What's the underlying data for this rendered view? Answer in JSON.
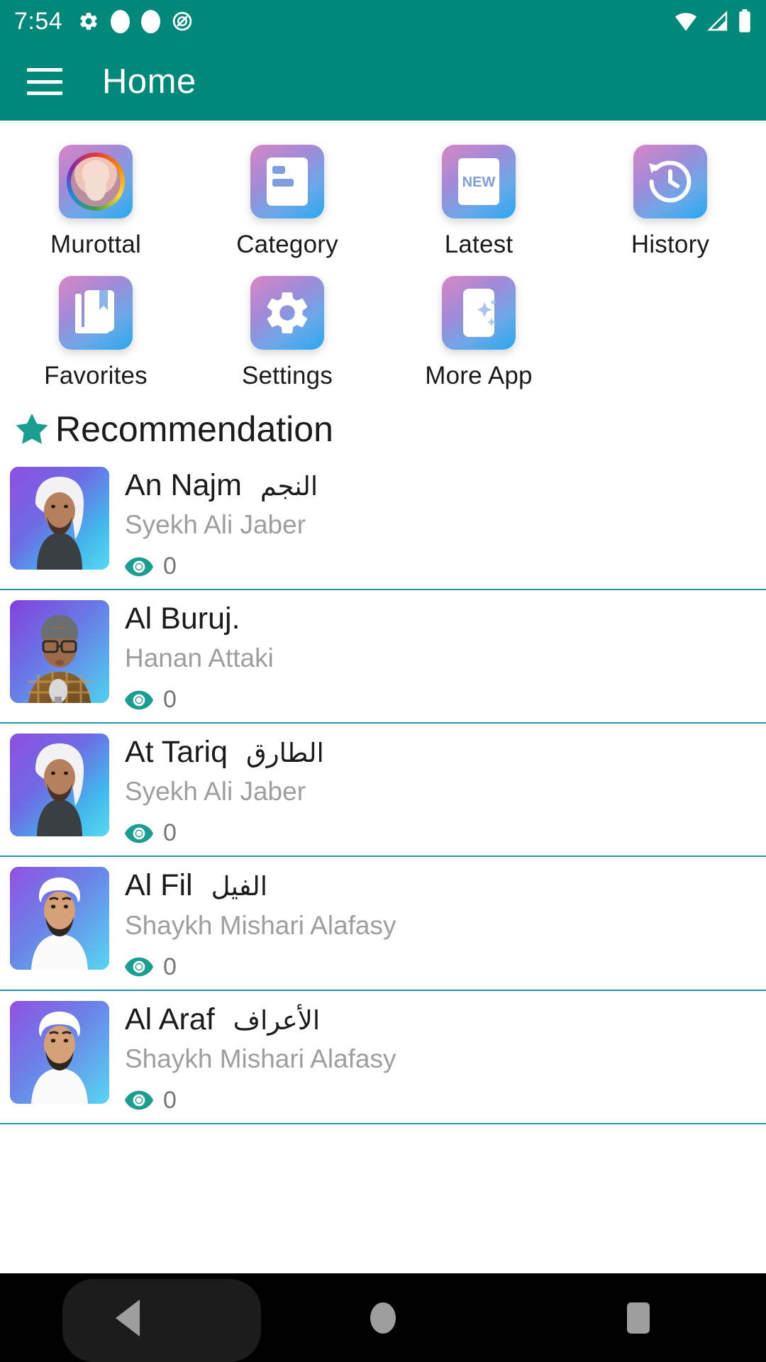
{
  "status_bar": {
    "time": "7:54",
    "left_icons": [
      "gear-icon",
      "dot-icon",
      "dot-icon",
      "no-entry-icon"
    ],
    "right_icons": [
      "wifi-icon",
      "signal-icon",
      "battery-icon"
    ]
  },
  "app_bar": {
    "menu_icon": "hamburger-menu-icon",
    "title": "Home",
    "background_color": "#00897B"
  },
  "grid_menu": {
    "items": [
      {
        "label": "Murottal",
        "icon": "avatar-portrait-icon"
      },
      {
        "label": "Category",
        "icon": "list-card-icon"
      },
      {
        "label": "Latest",
        "icon": "new-badge-icon"
      },
      {
        "label": "History",
        "icon": "clock-rotate-left-icon"
      },
      {
        "label": "Favorites",
        "icon": "bookmark-books-icon"
      },
      {
        "label": "Settings",
        "icon": "gear-icon"
      },
      {
        "label": "More App",
        "icon": "phone-sparkle-icon"
      }
    ]
  },
  "recommendation": {
    "icon": "star-icon",
    "title": "Recommendation",
    "accent_color": "#1a9e8f",
    "divider_color": "#2196a8",
    "items": [
      {
        "title": "An Najm",
        "arabic": "النجم",
        "reciter": "Syekh Ali Jaber",
        "views_icon": "eye-icon",
        "views": "0",
        "thumb": "syekh-ali-jaber-portrait"
      },
      {
        "title": "Al Buruj.",
        "arabic": "",
        "reciter": "Hanan Attaki",
        "views_icon": "eye-icon",
        "views": "0",
        "thumb": "hanan-attaki-portrait"
      },
      {
        "title": "At Tariq",
        "arabic": "الطارق",
        "reciter": "Syekh Ali Jaber",
        "views_icon": "eye-icon",
        "views": "0",
        "thumb": "syekh-ali-jaber-portrait"
      },
      {
        "title": "Al Fil",
        "arabic": "الفيل",
        "reciter": "Shaykh Mishari Alafasy",
        "views_icon": "eye-icon",
        "views": "0",
        "thumb": "mishari-alafasy-portrait"
      },
      {
        "title": "Al Araf",
        "arabic": "الأعراف",
        "reciter": "Shaykh Mishari Alafasy",
        "views_icon": "eye-icon",
        "views": "0",
        "thumb": "mishari-alafasy-portrait"
      }
    ]
  },
  "navigation_bar": {
    "back": "back-triangle-icon",
    "home": "home-circle-icon",
    "recents": "recents-square-icon"
  }
}
